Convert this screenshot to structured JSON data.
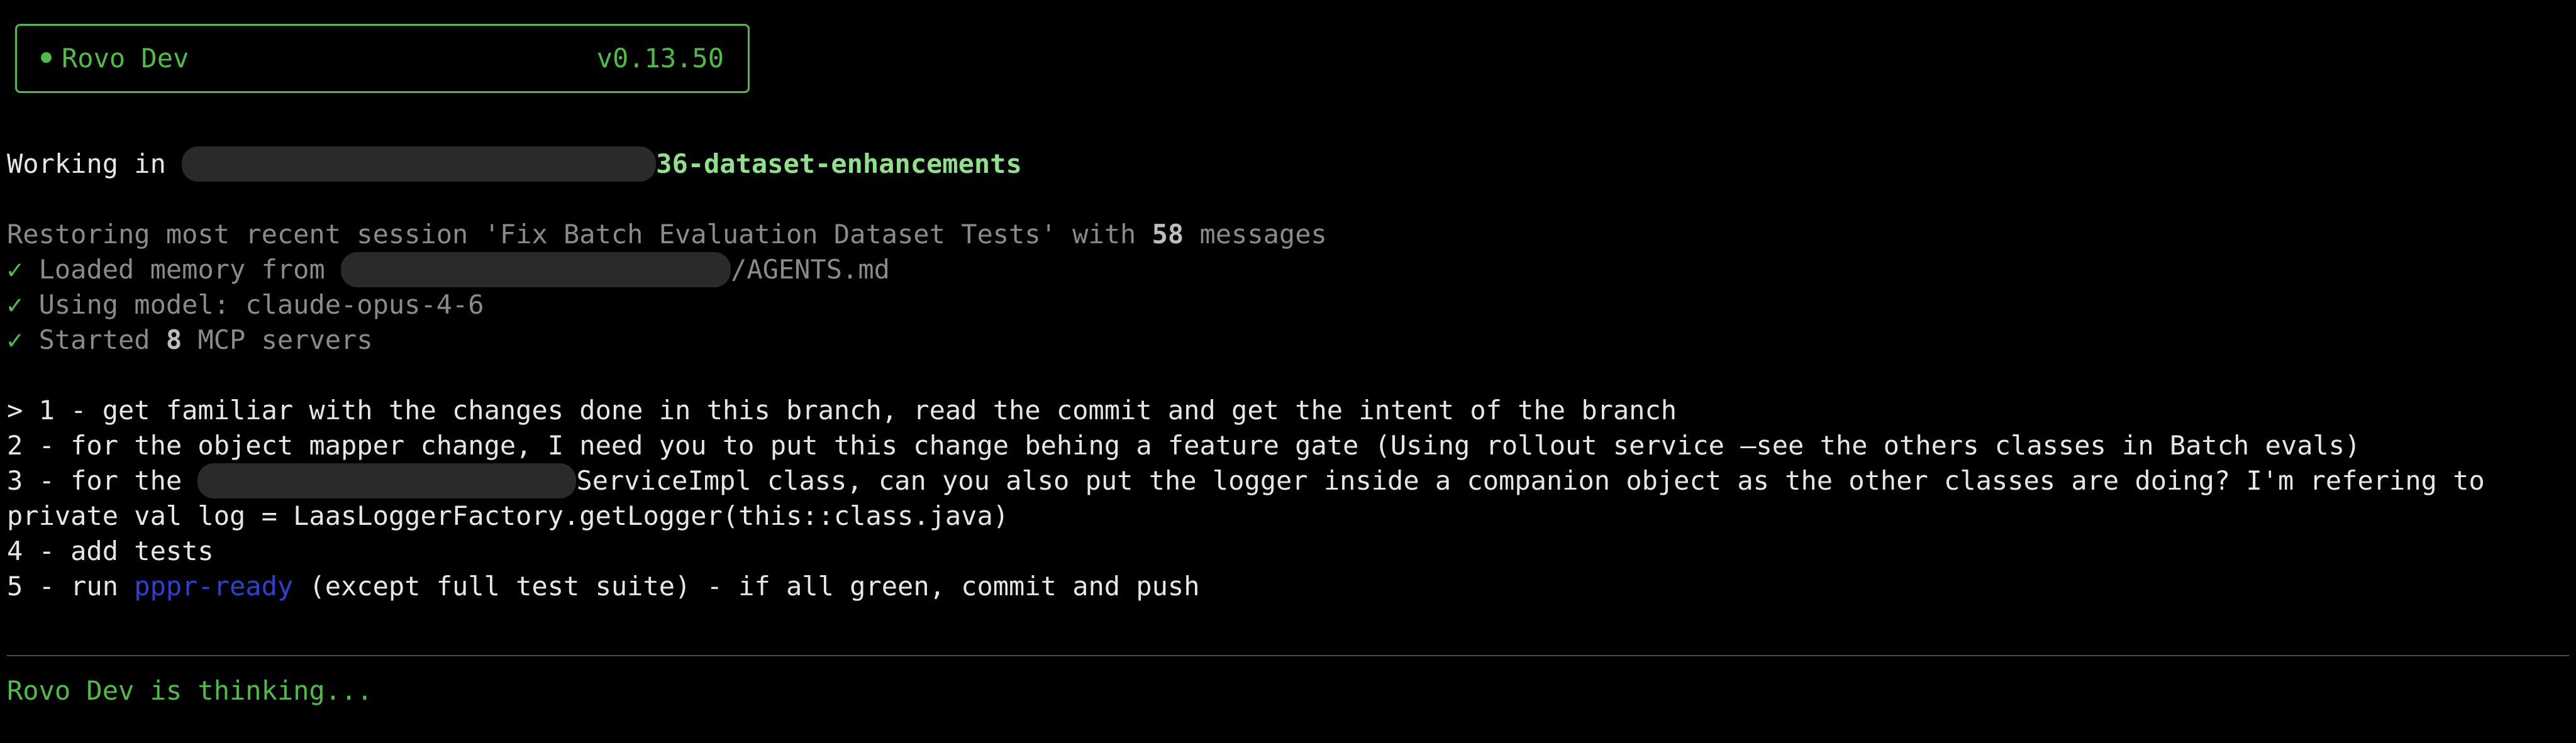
{
  "header": {
    "app_name": "Rovo Dev",
    "version": "v0.13.50"
  },
  "workspace": {
    "working_in_label": "Working in ",
    "branch_suffix": "36-dataset-enhancements"
  },
  "status": {
    "restore_prefix": "Restoring most recent session 'Fix Batch Evaluation Dataset Tests' with ",
    "restore_count": "58",
    "restore_suffix": " messages",
    "memory_check": "✓",
    "memory_prefix": " Loaded memory from ",
    "memory_suffix": "/AGENTS.md",
    "model_check": "✓",
    "model_text": " Using model: claude-opus-4-6",
    "mcp_check": "✓",
    "mcp_prefix": " Started ",
    "mcp_count": "8",
    "mcp_suffix": " MCP servers"
  },
  "prompt": {
    "line1": "> 1 - get familiar with the changes done in this branch, read the commit and get the intent of the branch",
    "line2": "2 - for the object mapper change, I need you to put this change behing a feature gate (Using rollout service —see the others classes in Batch evals)",
    "line3_prefix": "3 - for the ",
    "line3_suffix": "ServiceImpl class, can you also put the logger inside a companion object as the other classes are doing? I'm refering to",
    "line4": "private val log = LaasLoggerFactory.getLogger(this::class.java)",
    "line5": "4 - add tests",
    "line6_prefix": "5 - run ",
    "line6_link": "pppr-ready",
    "line6_suffix": " (except full test suite) - if all green, commit and push"
  },
  "thinking": {
    "text": "Rovo Dev is thinking..."
  },
  "colors": {
    "accent_green": "#4dbd45",
    "branch_green": "#8ee08a",
    "link_blue": "#2f3fd0",
    "dim_text": "#8a8a8a"
  }
}
